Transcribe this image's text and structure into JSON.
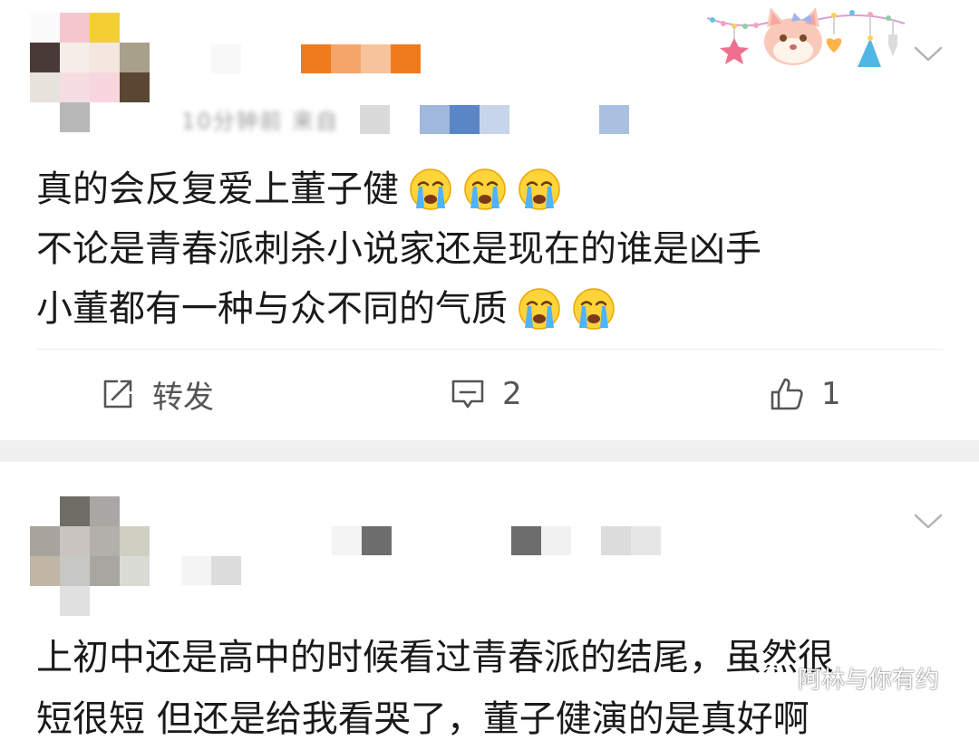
{
  "posts": [
    {
      "body_lines": [
        "真的会反复爱上董子健",
        "不论是青春派刺杀小说家还是现在的谁是凶手",
        "小董都有一种与众不同的气质"
      ],
      "actions": {
        "repost_label": "转发",
        "comment_count": "2",
        "like_count": "1"
      }
    },
    {
      "body_lines": [
        "上初中还是高中的时候看过青春派的结尾，虽然很",
        "短很短 但还是给我看哭了，董子健演的是真好啊"
      ]
    }
  ],
  "watermark": {
    "text": "阿林与你有约"
  },
  "icons": {
    "emoji": "loudly-crying-face",
    "repost": "share-icon",
    "comment": "comment-icon",
    "like": "thumbs-up-icon",
    "expand": "chevron-down-icon"
  },
  "colors": {
    "name_highlight": "#f07a1e",
    "meta_highlight": "#5b86c6",
    "page_gap": "#f0f0f0"
  }
}
